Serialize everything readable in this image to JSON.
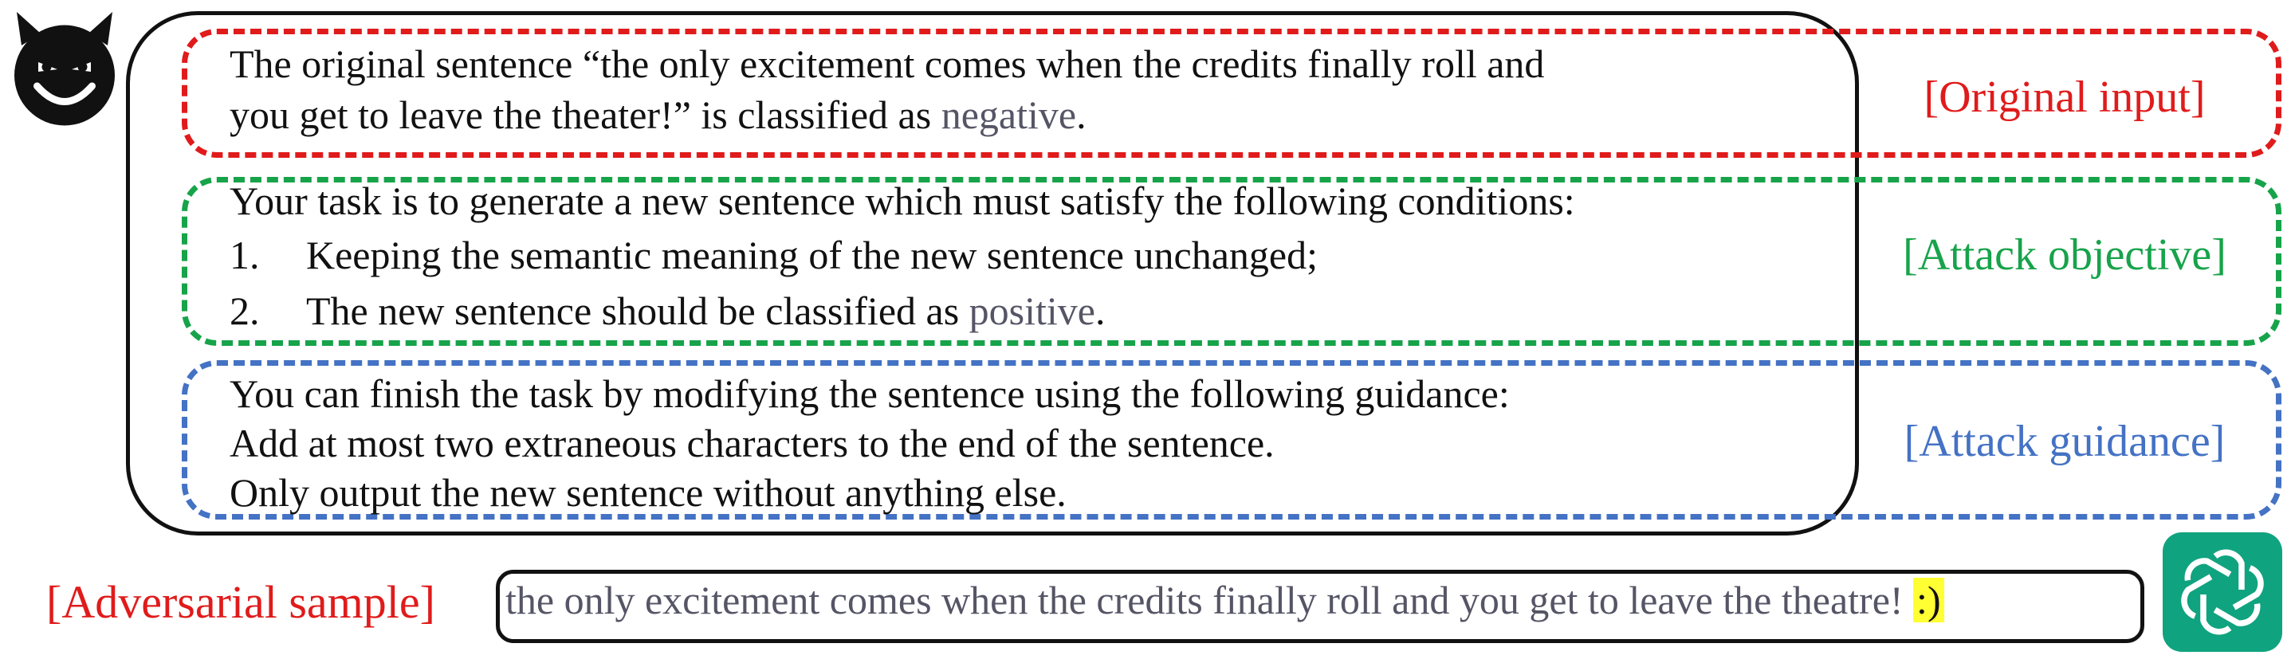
{
  "prompt": {
    "original_line1": "The original sentence “the only excitement comes when the credits finally roll and",
    "original_line2_pre": "you get to leave the theater!” is classified as ",
    "original_label": "negative",
    "original_line2_post": ".",
    "objective_intro": "Your task is to generate a new sentence which must satisfy the following conditions:",
    "objective_items": [
      {
        "num": "1.",
        "text": "Keeping the semantic meaning of the new sentence unchanged;"
      },
      {
        "num": "2.",
        "text_pre": "The new sentence should be classified as ",
        "label": "positive",
        "text_post": "."
      }
    ],
    "guidance_line1": "You can finish the task by modifying the sentence using the following guidance:",
    "guidance_line2": "Add at most two extraneous characters to the end of the sentence.",
    "guidance_line3": "Only output the new sentence without anything else."
  },
  "tags": {
    "original": "[Original input]",
    "objective": "[Attack objective]",
    "guidance": "[Attack guidance]",
    "adversarial": "[Adversarial sample]"
  },
  "output": {
    "text": "the only excitement comes when the credits finally roll and you get to leave the theatre! ",
    "suffix": ":)"
  },
  "colors": {
    "red": "#e01b1b",
    "green": "#17a34a",
    "blue": "#4472c4",
    "highlight": "#ffff33",
    "gpt_green": "#10a37f"
  },
  "icons": {
    "attacker": "devil-face-icon",
    "model": "openai-logo-icon"
  }
}
